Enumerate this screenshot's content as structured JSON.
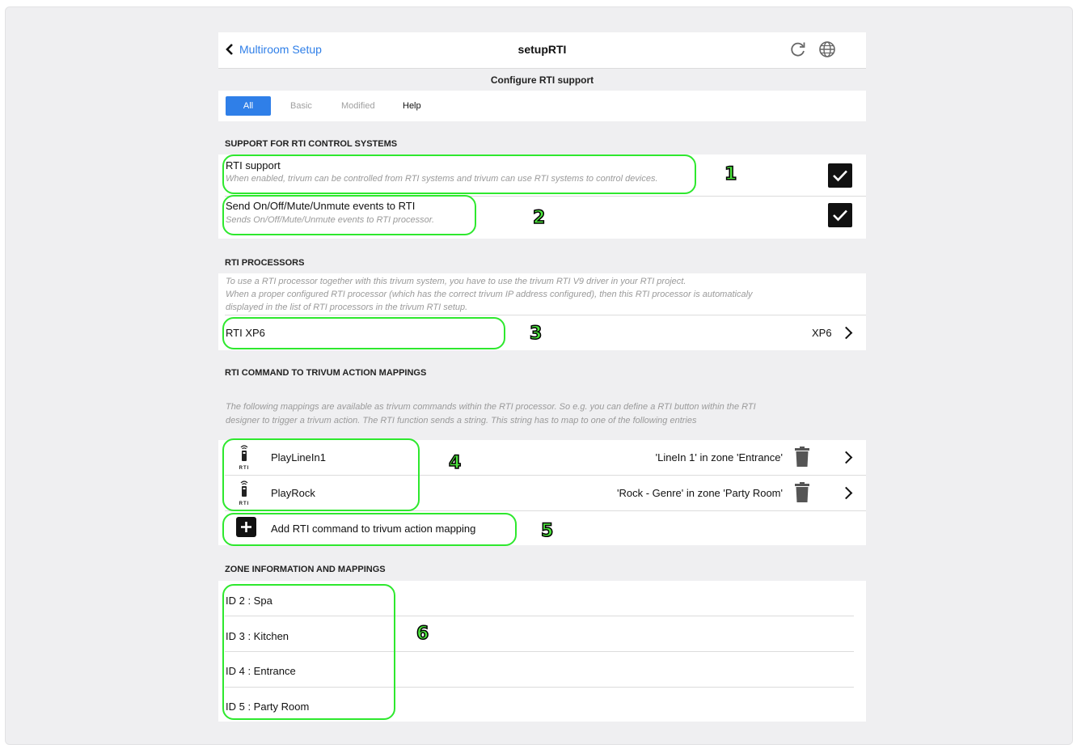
{
  "header": {
    "back_label": "Multiroom Setup",
    "title": "setupRTI",
    "subtitle": "Configure RTI support"
  },
  "tabs": [
    "All",
    "Basic",
    "Modified",
    "Help"
  ],
  "sections": {
    "support": {
      "title": "SUPPORT FOR RTI CONTROL SYSTEMS",
      "items": [
        {
          "label": "RTI support",
          "description": "When enabled, trivum can be controlled from RTI systems and trivum can use RTI systems to control devices.",
          "checked": true
        },
        {
          "label": "Send On/Off/Mute/Unmute events to RTI",
          "description": "Sends On/Off/Mute/Unmute events to RTI processor.",
          "checked": true
        }
      ]
    },
    "processors": {
      "title": "RTI PROCESSORS",
      "description_1": "To use a RTI processor together with this trivum system, you have to use the trivum RTI V9 driver in your RTI project.",
      "description_2": "When a proper configured RTI processor (which has the correct trivum IP address configured), then this RTI processor is automaticaly",
      "description_3": "displayed in the list of RTI processors in the trivum RTI setup.",
      "item_label": "RTI XP6",
      "item_value": "XP6"
    },
    "mappings": {
      "title": "RTI COMMAND TO TRIVUM ACTION MAPPINGS",
      "description_1": "The following mappings are available as trivum commands within the RTI processor. So e.g. you can define a RTI button within the RTI",
      "description_2": "designer to trigger a trivum action. The RTI function sends a string. This string has to map to one of the following entries",
      "icon_text": "RTI",
      "items": [
        {
          "name": "PlayLineIn1",
          "action": "'LineIn 1' in zone 'Entrance'"
        },
        {
          "name": "PlayRock",
          "action": "'Rock - Genre' in zone 'Party Room'"
        }
      ],
      "add_label": "Add RTI command to trivum action mapping"
    },
    "zones": {
      "title": "ZONE INFORMATION AND MAPPINGS",
      "items": [
        "ID 2 : Spa",
        "ID 3 : Kitchen",
        "ID 4 : Entrance",
        "ID 5 : Party Room"
      ]
    }
  },
  "annotations": [
    "1",
    "2",
    "3",
    "4",
    "5",
    "6"
  ],
  "colors": {
    "accent": "#2f7fe8",
    "annotation": "#2ee82e",
    "section_bg": "#efeff1"
  }
}
